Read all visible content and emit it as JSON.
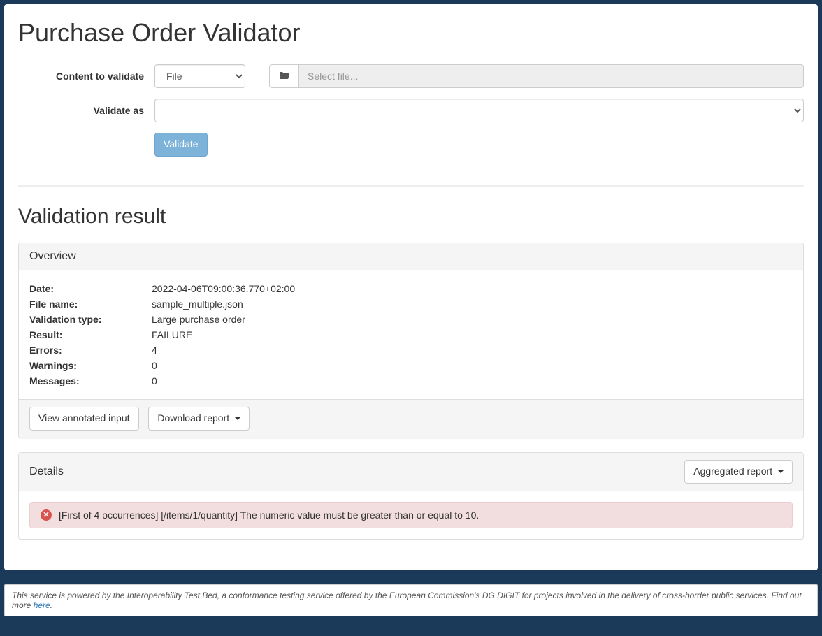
{
  "header": {
    "title": "Purchase Order Validator"
  },
  "form": {
    "content_label": "Content to validate",
    "content_select_value": "File",
    "file_placeholder": "Select file...",
    "validate_as_label": "Validate as",
    "validate_as_value": "",
    "validate_button": "Validate"
  },
  "result": {
    "heading": "Validation result",
    "overview_title": "Overview",
    "rows": {
      "date_label": "Date:",
      "date_value": "2022-04-06T09:00:36.770+02:00",
      "filename_label": "File name:",
      "filename_value": "sample_multiple.json",
      "valtype_label": "Validation type:",
      "valtype_value": "Large purchase order",
      "result_label": "Result:",
      "result_value": "FAILURE",
      "errors_label": "Errors:",
      "errors_value": "4",
      "warnings_label": "Warnings:",
      "warnings_value": "0",
      "messages_label": "Messages:",
      "messages_value": "0"
    },
    "actions": {
      "view_input": "View annotated input",
      "download_report": "Download report"
    }
  },
  "details": {
    "heading": "Details",
    "aggregated_button": "Aggregated report",
    "error_message": "[First of 4 occurrences] [/items/1/quantity] The numeric value must be greater than or equal to 10."
  },
  "footer": {
    "text": "This service is powered by the Interoperability Test Bed, a conformance testing service offered by the European Commission's DG DIGIT for projects involved in the delivery of cross-border public services. Find out more ",
    "link_text": "here",
    "suffix": "."
  }
}
